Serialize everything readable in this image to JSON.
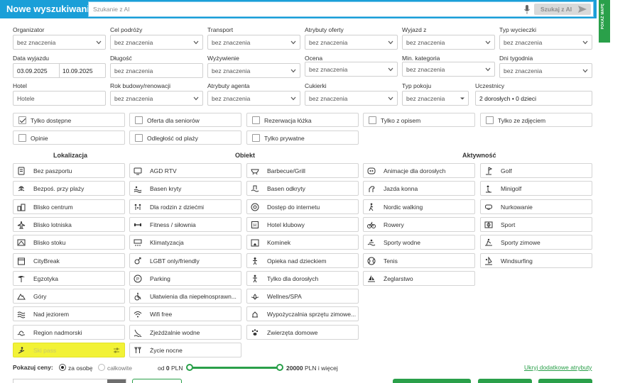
{
  "topbar": {
    "title": "Nowe wyszukiwanie",
    "search_placeholder": "Szukanie z AI",
    "ai_button": "Szukaj z AI",
    "map_button": "POKAŻ MAPĘ"
  },
  "filters": {
    "organizator": {
      "label": "Organizator",
      "value": "bez znaczenia"
    },
    "cel_podrozy": {
      "label": "Cel podróży",
      "value": "bez znaczenia"
    },
    "transport": {
      "label": "Transport",
      "value": "bez znaczenia"
    },
    "atrybuty_oferty": {
      "label": "Atrybuty oferty",
      "value": "bez znaczenia"
    },
    "wyjazd_z": {
      "label": "Wyjazd z",
      "value": "bez znaczenia"
    },
    "typ_wycieczki": {
      "label": "Typ wycieczki",
      "value": "bez znaczenia"
    },
    "data_wyjazdu": {
      "label": "Data wyjazdu",
      "from": "03.09.2025",
      "to": "10.09.2025"
    },
    "dlugosc": {
      "label": "Długość",
      "value": "bez znaczenia"
    },
    "wyzywienie": {
      "label": "Wyżywienie",
      "value": "bez znaczenia"
    },
    "ocena": {
      "label": "Ocena",
      "value": "bez znaczenia"
    },
    "min_kategoria": {
      "label": "Min. kategoria",
      "value": "bez znaczenia"
    },
    "dni_tygodnia": {
      "label": "Dni tygodnia",
      "value": "bez znaczenia"
    },
    "hotel": {
      "label": "Hotel",
      "placeholder": "Hotele"
    },
    "rok_budowy": {
      "label": "Rok budowy/renowacji",
      "value": "bez znaczenia"
    },
    "atrybuty_agenta": {
      "label": "Atrybuty agenta",
      "value": "bez znaczenia"
    },
    "cukierki": {
      "label": "Cukierki",
      "value": "bez znaczenia"
    },
    "typ_pokoju": {
      "label": "Typ pokoju",
      "value": "bez znaczenia"
    },
    "uczestnicy": {
      "label": "Uczestnicy",
      "value": "2 dorosłych • 0 dzieci"
    }
  },
  "checkboxes": [
    {
      "label": "Tylko dostępne",
      "checked": true
    },
    {
      "label": "Oferta dla seniorów",
      "checked": false
    },
    {
      "label": "Rezerwacja łóżka",
      "checked": false
    },
    {
      "label": "Tylko z opisem",
      "checked": false
    },
    {
      "label": "Tylko ze zdjęciem",
      "checked": false
    },
    {
      "label": "Opinie",
      "checked": false
    },
    {
      "label": "Odległość od plaży",
      "checked": false
    },
    {
      "label": "Tylko prywatne",
      "checked": false
    }
  ],
  "sections": {
    "lokalizacja": "Lokalizacja",
    "obiekt": "Obiekt",
    "aktywnosc": "Aktywność"
  },
  "lokalizacja": [
    {
      "label": "Bez paszportu",
      "icon": "passport-icon"
    },
    {
      "label": "Bezpoś. przy plaży",
      "icon": "beach-icon"
    },
    {
      "label": "Blisko centrum",
      "icon": "city-center-icon"
    },
    {
      "label": "Blisko lotniska",
      "icon": "airport-icon"
    },
    {
      "label": "Blisko stoku",
      "icon": "ski-slope-icon"
    },
    {
      "label": "CityBreak",
      "icon": "calendar-icon"
    },
    {
      "label": "Egzotyka",
      "icon": "palm-icon"
    },
    {
      "label": "Góry",
      "icon": "mountain-icon"
    },
    {
      "label": "Nad jeziorem",
      "icon": "waves-icon"
    },
    {
      "label": "Region nadmorski",
      "icon": "sea-icon"
    },
    {
      "label": "Ski pass",
      "icon": "ski-icon"
    }
  ],
  "obiekt_col1": [
    {
      "label": "AGD RTV",
      "icon": "tv-icon"
    },
    {
      "label": "Basen kryty",
      "icon": "pool-indoor-icon"
    },
    {
      "label": "Dla rodzin z dziećmi",
      "icon": "family-icon"
    },
    {
      "label": "Fitness / siłownia",
      "icon": "dumbbell-icon"
    },
    {
      "label": "Klimatyzacja",
      "icon": "ac-icon"
    },
    {
      "label": "LGBT only/friendly",
      "icon": "lgbt-icon"
    },
    {
      "label": "Parking",
      "icon": "parking-icon"
    },
    {
      "label": "Ułatwienia dla niepełnosprawn...",
      "icon": "wheelchair-icon"
    },
    {
      "label": "Wifi free",
      "icon": "wifi-icon"
    },
    {
      "label": "Zjeżdżalnie wodne",
      "icon": "waterslide-icon"
    },
    {
      "label": "Życie nocne",
      "icon": "nightlife-icon"
    }
  ],
  "obiekt_col2": [
    {
      "label": "Barbecue/Grill",
      "icon": "grill-icon"
    },
    {
      "label": "Basen odkryty",
      "icon": "pool-outdoor-icon"
    },
    {
      "label": "Dostęp do internetu",
      "icon": "at-icon"
    },
    {
      "label": "Hotel klubowy",
      "icon": "hotel-icon"
    },
    {
      "label": "Kominek",
      "icon": "fireplace-icon"
    },
    {
      "label": "Opieka nad dzieckiem",
      "icon": "child-icon"
    },
    {
      "label": "Tylko dla dorosłych",
      "icon": "adult-icon"
    },
    {
      "label": "Wellnes/SPA",
      "icon": "spa-icon"
    },
    {
      "label": "Wypożyczalnia sprzętu zimowe...",
      "icon": "ski-rental-icon"
    },
    {
      "label": "Zwierzęta domowe",
      "icon": "pet-icon"
    }
  ],
  "aktywnosc_col1": [
    {
      "label": "Animacje dla dorosłych",
      "icon": "animation-icon"
    },
    {
      "label": "Jazda konna",
      "icon": "horse-icon"
    },
    {
      "label": "Nordic walking",
      "icon": "walking-icon"
    },
    {
      "label": "Rowery",
      "icon": "bike-icon"
    },
    {
      "label": "Sporty wodne",
      "icon": "water-sport-icon"
    },
    {
      "label": "Tenis",
      "icon": "tennis-icon"
    },
    {
      "label": "Żeglarstwo",
      "icon": "sailing-icon"
    }
  ],
  "aktywnosc_col2": [
    {
      "label": "Golf",
      "icon": "golf-icon"
    },
    {
      "label": "Minigolf",
      "icon": "minigolf-icon"
    },
    {
      "label": "Nurkowanie",
      "icon": "diving-icon"
    },
    {
      "label": "Sport",
      "icon": "sport-icon"
    },
    {
      "label": "Sporty zimowe",
      "icon": "winter-sport-icon"
    },
    {
      "label": "Windsurfing",
      "icon": "windsurf-icon"
    }
  ],
  "price": {
    "label": "Pokazuj ceny:",
    "per_person": "za osobę",
    "total": "całkowite",
    "from_prefix": "od",
    "from_value": "0",
    "currency": "PLN",
    "to_value": "20000",
    "to_suffix": "PLN i więcej",
    "hide_link": "Ukryj dodatkowe atrybuty"
  },
  "colors": {
    "header_blue": "#1a9fd8",
    "accent_green": "#2aa04a",
    "highlight_yellow": "#f2f236"
  }
}
